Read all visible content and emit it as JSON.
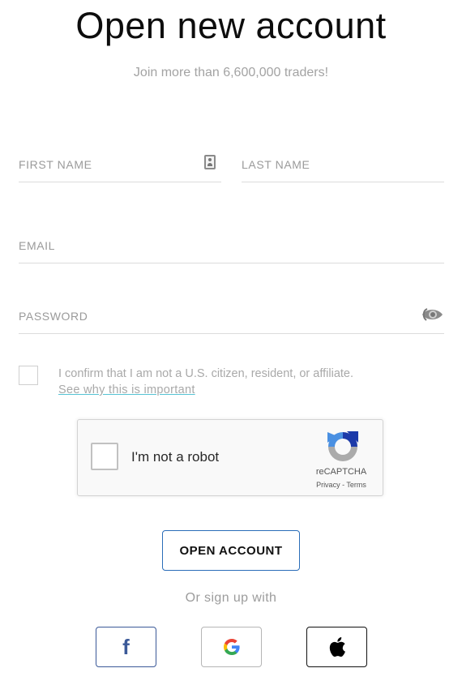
{
  "header": {
    "title": "Open new account",
    "subtitle": "Join more than 6,600,000 traders!"
  },
  "form": {
    "first_name": {
      "placeholder": "FIRST NAME",
      "value": "",
      "icon": "contact-card-icon"
    },
    "last_name": {
      "placeholder": "LAST NAME",
      "value": ""
    },
    "email": {
      "placeholder": "EMAIL",
      "value": ""
    },
    "password": {
      "placeholder": "PASSWORD",
      "value": "",
      "icon": "eye-icon"
    },
    "confirm": {
      "checked": false,
      "text": "I confirm that I am not a U.S. citizen, resident, or affiliate.",
      "link": "See why this is important"
    }
  },
  "captcha": {
    "label": "I'm not a robot",
    "brand": "reCAPTCHA",
    "privacy": "Privacy",
    "separator": " - ",
    "terms": "Terms",
    "checked": false
  },
  "actions": {
    "open_account": "OPEN ACCOUNT",
    "or_text": "Or sign up with"
  },
  "social": [
    {
      "name": "facebook",
      "icon": "facebook-icon",
      "glyph": "f",
      "color": "#3b5998"
    },
    {
      "name": "google",
      "icon": "google-icon"
    },
    {
      "name": "apple",
      "icon": "apple-icon"
    }
  ],
  "colors": {
    "accent_blue": "#2a6db8",
    "link_underline": "#56c3d4",
    "facebook": "#3b5998"
  }
}
